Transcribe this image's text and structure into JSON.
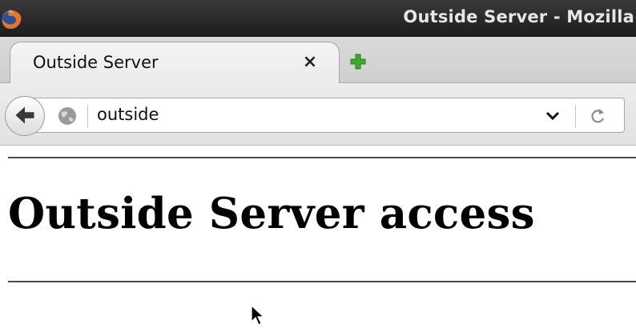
{
  "window": {
    "title": "Outside Server - Mozilla"
  },
  "tabs": [
    {
      "label": "Outside Server",
      "close_icon": "close-icon",
      "active": true
    }
  ],
  "navbar": {
    "url": "outside"
  },
  "page": {
    "heading": "Outside Server access"
  },
  "icons": {
    "app": "firefox-logo-icon",
    "new_tab": "plus-icon",
    "back": "back-arrow-icon",
    "site_identity": "globe-icon",
    "url_history": "chevron-down-icon",
    "reload": "reload-icon",
    "cursor": "mouse-pointer-icon"
  },
  "colors": {
    "titlebar": "#1c1c1c",
    "title_text": "#e6e6e6",
    "new_tab_green": "#3faa2a",
    "heading": "#000000"
  }
}
